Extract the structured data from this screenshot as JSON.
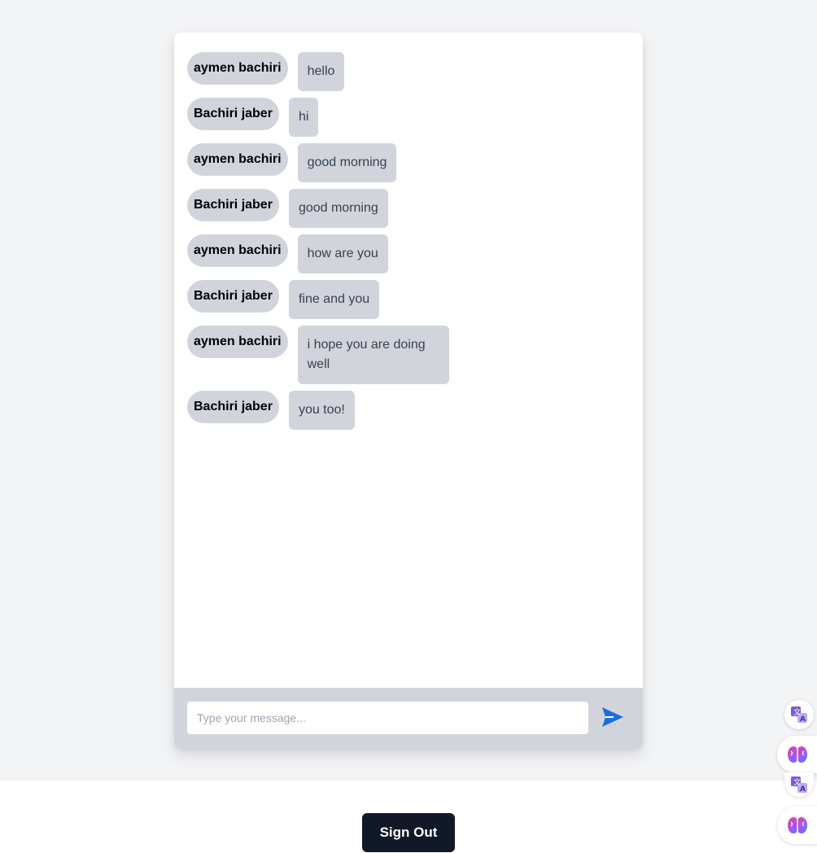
{
  "messages": [
    {
      "sender": "aymen bachiri",
      "text": "hello"
    },
    {
      "sender": "Bachiri jaber",
      "text": "hi"
    },
    {
      "sender": "aymen bachiri",
      "text": "good morning"
    },
    {
      "sender": "Bachiri jaber",
      "text": "good morning"
    },
    {
      "sender": "aymen bachiri",
      "text": "how are you"
    },
    {
      "sender": "Bachiri jaber",
      "text": "fine and you"
    },
    {
      "sender": "aymen bachiri",
      "text": "i hope you are doing well"
    },
    {
      "sender": "Bachiri jaber",
      "text": "you too!"
    }
  ],
  "composer": {
    "placeholder": "Type your message...",
    "value": "",
    "send_icon": "send-icon"
  },
  "footer": {
    "signout_label": "Sign Out"
  },
  "side_widgets": [
    {
      "icon": "translate-icon"
    },
    {
      "icon": "brain-icon"
    },
    {
      "icon": "translate-icon"
    },
    {
      "icon": "brain-icon"
    }
  ],
  "colors": {
    "accent": "#1a6fe0",
    "bubble": "#d1d5db",
    "signout": "#111827"
  }
}
